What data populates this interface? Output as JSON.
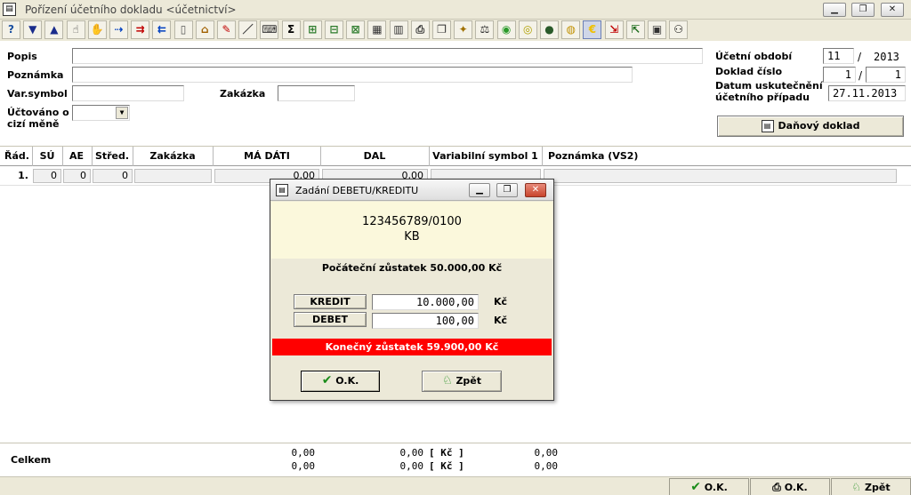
{
  "window": {
    "title": "Pořízení účetního dokladu <účetnictví>",
    "app_icon_glyph": "▤"
  },
  "toolbar": {
    "icons": [
      {
        "name": "help-icon",
        "glyph": "?"
      },
      {
        "name": "arrow-down-icon",
        "glyph": "▼"
      },
      {
        "name": "arrow-up-icon",
        "glyph": "▲"
      },
      {
        "name": "hand-pointer-icon",
        "glyph": "☝"
      },
      {
        "name": "hand-stop-icon",
        "glyph": "✋"
      },
      {
        "name": "insert-row-icon",
        "glyph": "⇢"
      },
      {
        "name": "add-row-icon",
        "glyph": "⇉"
      },
      {
        "name": "remove-row-icon",
        "glyph": "⇇"
      },
      {
        "name": "notepad-icon",
        "glyph": "▯"
      },
      {
        "name": "bag-icon",
        "glyph": "⌂"
      },
      {
        "name": "edit-document-icon",
        "glyph": "✎"
      },
      {
        "name": "pencil-icon",
        "glyph": "／"
      },
      {
        "name": "keyboard-icon",
        "glyph": "⌨"
      },
      {
        "name": "sum-icon",
        "glyph": "Σ"
      },
      {
        "name": "tree-icon",
        "glyph": "⊞"
      },
      {
        "name": "tree-move-icon",
        "glyph": "⊟"
      },
      {
        "name": "tree-people-icon",
        "glyph": "⊠"
      },
      {
        "name": "calculator-icon",
        "glyph": "▦"
      },
      {
        "name": "book-icon",
        "glyph": "▥"
      },
      {
        "name": "printer-icon",
        "glyph": "⎙"
      },
      {
        "name": "copy-document-icon",
        "glyph": "❐"
      },
      {
        "name": "document-star-icon",
        "glyph": "✦"
      },
      {
        "name": "scales-icon",
        "glyph": "⚖"
      },
      {
        "name": "green-circle-icon",
        "glyph": "◉"
      },
      {
        "name": "yellow-circle-icon",
        "glyph": "◎"
      },
      {
        "name": "dark-circle-icon",
        "glyph": "●"
      },
      {
        "name": "gold-coin-icon",
        "glyph": "◍"
      },
      {
        "name": "euro-icon",
        "glyph": "€"
      },
      {
        "name": "document-import-icon",
        "glyph": "⇲"
      },
      {
        "name": "document-export-icon",
        "glyph": "⇱"
      },
      {
        "name": "monitor-icon",
        "glyph": "▣"
      },
      {
        "name": "binoculars-icon",
        "glyph": "⚇"
      }
    ]
  },
  "form": {
    "popis_label": "Popis",
    "popis_value": "",
    "poznamka_label": "Poznámka",
    "poznamka_value": "",
    "varsymbol_label": "Var.symbol",
    "varsymbol_value": "",
    "zakazka_label": "Zakázka",
    "zakazka_value": "",
    "cizi_mena_label_1": "Účtováno o",
    "cizi_mena_label_2": "cizí měně",
    "cizi_mena_value": "",
    "ucetni_obdobi_label": "Účetní období",
    "ucetni_obdobi_month": "11",
    "ucetni_obdobi_sep": "/",
    "ucetni_obdobi_year": "2013",
    "doklad_cislo_label": "Doklad číslo",
    "doklad_cislo_1": "1",
    "doklad_cislo_sep": "/",
    "doklad_cislo_2": "1",
    "datum_label_1": "Datum uskutečnění",
    "datum_label_2": "účetního případu",
    "datum_value": "27.11.2013",
    "danovy_doklad_label": "Daňový doklad"
  },
  "table": {
    "headers": [
      "Řád.",
      "SÚ",
      "AE",
      "Střed.",
      "Zakázka",
      "MÁ DÁTI",
      "DAL",
      "Variabilní symbol 1",
      "Poznámka (VS2)"
    ],
    "rows": [
      {
        "rad": "1.",
        "su": "0",
        "ae": "0",
        "stred": "0",
        "zakazka": "",
        "ma_dati": "0,00",
        "dal": "0,00",
        "vs1": "",
        "pozn": ""
      }
    ]
  },
  "footer": {
    "celkem_label": "Celkem",
    "ma_dati_1": "0,00",
    "ma_dati_2": "0,00",
    "dal_1": "0,00",
    "dal_2": "0,00",
    "currency_1": "[ Kč ]",
    "currency_2": "[ Kč ]",
    "diff_1": "0,00",
    "diff_2": "0,00"
  },
  "bottom_buttons": {
    "ok_label": "O.K.",
    "print_ok_label": "O.K.",
    "back_label": "Zpět"
  },
  "dialog": {
    "title": "Zadání DEBETU/KREDITU",
    "account_number": "123456789/0100",
    "bank": "KB",
    "opening_balance": "Počáteční zůstatek 50.000,00 Kč",
    "kredit_label": "KREDIT",
    "kredit_value": "10.000,00",
    "kredit_currency": "Kč",
    "debet_label": "DEBET",
    "debet_value": "100,00",
    "debet_currency": "Kč",
    "closing_balance": "Konečný zůstatek 59.900,00 Kč",
    "ok_label": "O.K.",
    "back_label": "Zpět"
  },
  "colors": {
    "closing_balance_bg": "#ff0000",
    "account_box_bg": "#fbf8dc",
    "window_bg": "#ece9d8"
  }
}
